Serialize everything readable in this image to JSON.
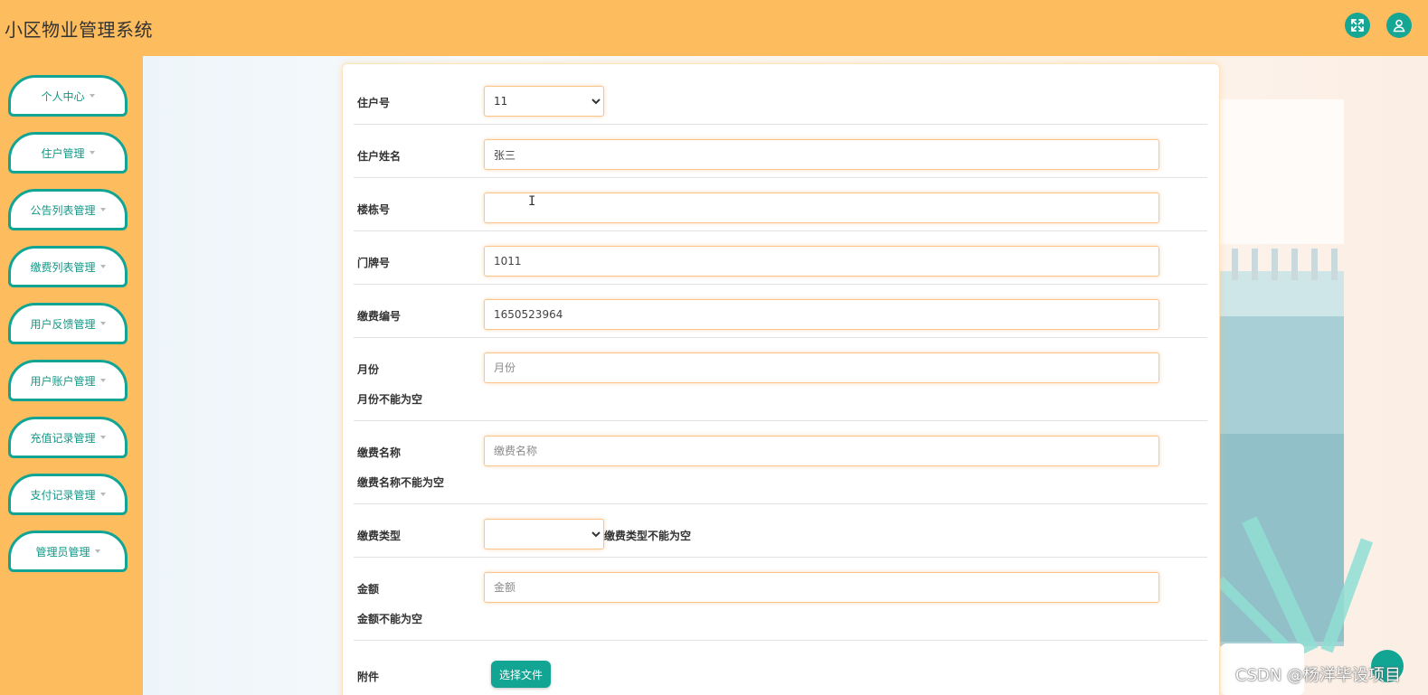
{
  "app": {
    "title": "小区物业管理系统"
  },
  "header": {
    "fullscreen_icon": "fullscreen-expand-icon",
    "user_icon": "user-icon",
    "accent": "#15a694",
    "background": "#fdbc5e"
  },
  "sidebar": {
    "items": [
      {
        "label": "个人中心"
      },
      {
        "label": "住户管理"
      },
      {
        "label": "公告列表管理"
      },
      {
        "label": "缴费列表管理"
      },
      {
        "label": "用户反馈管理"
      },
      {
        "label": "用户账户管理"
      },
      {
        "label": "充值记录管理"
      },
      {
        "label": "支付记录管理"
      },
      {
        "label": "管理员管理"
      }
    ]
  },
  "form": {
    "resident_no": {
      "label": "住户号",
      "value": "11"
    },
    "resident_name": {
      "label": "住户姓名",
      "value": "张三"
    },
    "building_no": {
      "label": "楼栋号",
      "value": ""
    },
    "door_no": {
      "label": "门牌号",
      "value": "1011"
    },
    "fee_no": {
      "label": "缴费编号",
      "value": "1650523964"
    },
    "month": {
      "label": "月份",
      "placeholder": "月份",
      "error": "月份不能为空"
    },
    "fee_name": {
      "label": "缴费名称",
      "placeholder": "缴费名称",
      "error": "缴费名称不能为空"
    },
    "fee_type": {
      "label": "缴费类型",
      "value": "",
      "error": "缴费类型不能为空"
    },
    "amount": {
      "label": "金额",
      "placeholder": "金额",
      "error": "金额不能为空"
    },
    "attachment": {
      "label": "附件",
      "button": "选择文件"
    }
  },
  "watermark": "CSDN @杨洋毕设项目"
}
